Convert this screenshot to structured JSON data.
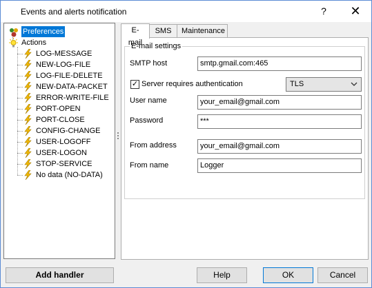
{
  "window": {
    "title": "Events and alerts notification",
    "help_glyph": "?",
    "close_glyph": "✕"
  },
  "tree": {
    "root_preferences": "Preferences",
    "root_actions": "Actions",
    "actions": [
      "LOG-MESSAGE",
      "NEW-LOG-FILE",
      "LOG-FILE-DELETE",
      "NEW-DATA-PACKET",
      "ERROR-WRITE-FILE",
      "PORT-OPEN",
      "PORT-CLOSE",
      "CONFIG-CHANGE",
      "USER-LOGOFF",
      "USER-LOGON",
      "STOP-SERVICE",
      "No data (NO-DATA)"
    ]
  },
  "tabs": [
    "E-mail",
    "SMS",
    "Maintenance"
  ],
  "email": {
    "group_title": "E-mail settings",
    "smtp_label": "SMTP host",
    "smtp_value": "smtp.gmail.com:465",
    "auth_label": "Server requires authentication",
    "auth_checked": "✓",
    "security_value": "TLS",
    "username_label": "User name",
    "username_value": "your_email@gmail.com",
    "password_label": "Password",
    "password_value": "***",
    "from_address_label": "From address",
    "from_address_value": "your_email@gmail.com",
    "from_name_label": "From name",
    "from_name_value": "Logger"
  },
  "buttons": {
    "add_handler": "Add handler",
    "help": "Help",
    "ok": "OK",
    "cancel": "Cancel"
  },
  "colors": {
    "accent": "#0078d7",
    "lightning": "#f2b900"
  }
}
